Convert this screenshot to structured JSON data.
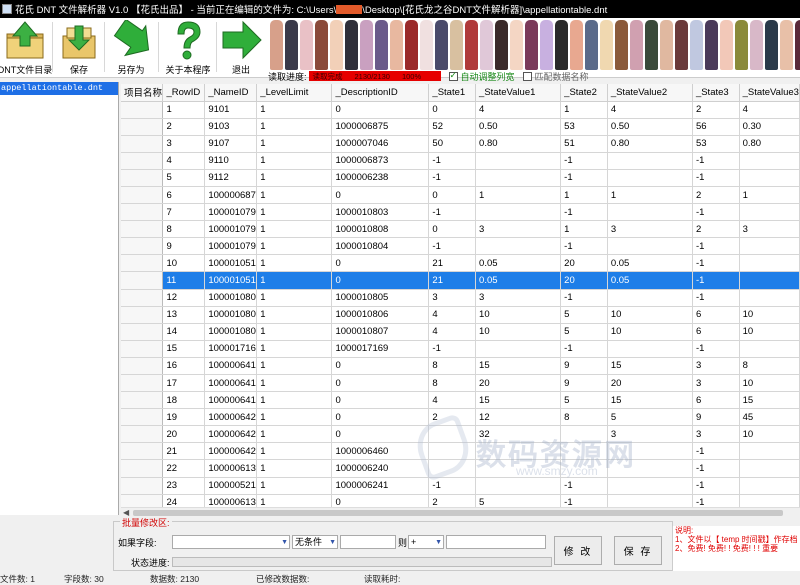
{
  "window": {
    "title_prefix": "花氏 DNT 文件解析器 V1.0 【花氏出品】 - 当前正在编辑的文件为:  C:\\Users\\",
    "title_suffix": "\\Desktop\\[花氏龙之谷DNT文件解析器]\\appellationtable.dnt"
  },
  "toolbar": {
    "buttons": [
      {
        "label": "DNT文件目录",
        "icon": "folder-upload-icon"
      },
      {
        "label": "保存",
        "icon": "save-box-icon"
      },
      {
        "label": "另存为",
        "icon": "save-as-arrow-icon"
      },
      {
        "label": "关于本程序",
        "icon": "question-icon"
      },
      {
        "label": "退出",
        "icon": "exit-arrow-icon"
      }
    ]
  },
  "progress": {
    "label": "读取进度:",
    "bar_text_1": "读取完成",
    "bar_text_2": "2130/2130",
    "bar_percent": "100%",
    "auto_adjust_label": "自动调整列宽",
    "auto_adjust_checked": true,
    "match_label": "匹配数据名称",
    "match_checked": false
  },
  "filelist": {
    "items": [
      "appellationtable.dnt"
    ]
  },
  "grid": {
    "columns": [
      "项目名称",
      "_RowID",
      "_NameID",
      "_LevelLimit",
      "_DescriptionID",
      "_State1",
      "_StateValue1",
      "_State2",
      "_StateValue2",
      "_State3",
      "_StateValue3"
    ],
    "selected_row_index": 10,
    "rows": [
      [
        "",
        "1",
        "9101",
        "1",
        "0",
        "0",
        "4",
        "1",
        "4",
        "2",
        "4"
      ],
      [
        "",
        "2",
        "9103",
        "1",
        "1000006875",
        "52",
        "0.50",
        "53",
        "0.50",
        "56",
        "0.30"
      ],
      [
        "",
        "3",
        "9107",
        "1",
        "1000007046",
        "50",
        "0.80",
        "51",
        "0.80",
        "53",
        "0.80"
      ],
      [
        "",
        "4",
        "9110",
        "1",
        "1000006873",
        "-1",
        "",
        "-1",
        "",
        "-1",
        ""
      ],
      [
        "",
        "5",
        "9112",
        "1",
        "1000006238",
        "-1",
        "",
        "-1",
        "",
        "-1",
        ""
      ],
      [
        "",
        "6",
        "100000687",
        "1",
        "0",
        "0",
        "1",
        "1",
        "1",
        "2",
        "1"
      ],
      [
        "",
        "7",
        "100001079",
        "1",
        "1000010803",
        "-1",
        "",
        "-1",
        "",
        "-1",
        ""
      ],
      [
        "",
        "8",
        "100001079",
        "1",
        "1000010808",
        "0",
        "3",
        "1",
        "3",
        "2",
        "3"
      ],
      [
        "",
        "9",
        "100001079",
        "1",
        "1000010804",
        "-1",
        "",
        "-1",
        "",
        "-1",
        ""
      ],
      [
        "",
        "10",
        "100001051",
        "1",
        "0",
        "21",
        "0.05",
        "20",
        "0.05",
        "-1",
        ""
      ],
      [
        "",
        "11",
        "100001051",
        "1",
        "0",
        "21",
        "0.05",
        "20",
        "0.05",
        "-1",
        ""
      ],
      [
        "",
        "12",
        "100001080",
        "1",
        "1000010805",
        "3",
        "3",
        "-1",
        "",
        "-1",
        ""
      ],
      [
        "",
        "13",
        "100001080",
        "1",
        "1000010806",
        "4",
        "10",
        "5",
        "10",
        "6",
        "10"
      ],
      [
        "",
        "14",
        "100001080",
        "1",
        "1000010807",
        "4",
        "10",
        "5",
        "10",
        "6",
        "10"
      ],
      [
        "",
        "15",
        "100001716",
        "1",
        "1000017169",
        "-1",
        "",
        "-1",
        "",
        "-1",
        ""
      ],
      [
        "",
        "16",
        "100000641",
        "1",
        "0",
        "8",
        "15",
        "9",
        "15",
        "3",
        "8"
      ],
      [
        "",
        "17",
        "100000641",
        "1",
        "0",
        "8",
        "20",
        "9",
        "20",
        "3",
        "10"
      ],
      [
        "",
        "18",
        "100000641",
        "1",
        "0",
        "4",
        "15",
        "5",
        "15",
        "6",
        "15"
      ],
      [
        "",
        "19",
        "100000642",
        "1",
        "0",
        "2",
        "12",
        "8",
        "5",
        "9",
        "45"
      ],
      [
        "",
        "20",
        "100000642",
        "1",
        "0",
        "",
        "32",
        "",
        "3",
        "3",
        "10"
      ],
      [
        "",
        "21",
        "100000642",
        "1",
        "1000006460",
        "",
        "",
        "",
        "",
        "-1",
        ""
      ],
      [
        "",
        "22",
        "100000613",
        "1",
        "1000006240",
        "",
        "",
        "",
        "",
        "-1",
        ""
      ],
      [
        "",
        "23",
        "100000521",
        "1",
        "1000006241",
        "-1",
        "",
        "-1",
        "",
        "-1",
        ""
      ],
      [
        "",
        "24",
        "100000613",
        "1",
        "0",
        "2",
        "5",
        "-1",
        "",
        "-1",
        ""
      ]
    ]
  },
  "batch": {
    "legend": "批量修改区:",
    "if_field_label": "如果字段:",
    "condition_value": "无条件",
    "then_label": "则",
    "operator_value": "+",
    "status_label": "状态进度:",
    "modify_button": "修 改",
    "save_button": "保 存"
  },
  "notes": {
    "title": "说明:",
    "line1": "1、文件以【 temp 时间戳】作存档",
    "line2": "2、免费! 免费! ! 免费! ! ! 重要"
  },
  "statusbar": {
    "file_count": "文件数: 1",
    "field_count": "字段数: 30",
    "row_count": "数据数: 2130",
    "modified_count": "已修改数据数:",
    "elapsed": "读取耗时:"
  },
  "watermark": {
    "text": "数码资源网",
    "url": "www.smzy.com"
  },
  "colors": {
    "selection": "#1e7ee8",
    "progress_red": "#e60000",
    "notes_red": "#e00000"
  }
}
